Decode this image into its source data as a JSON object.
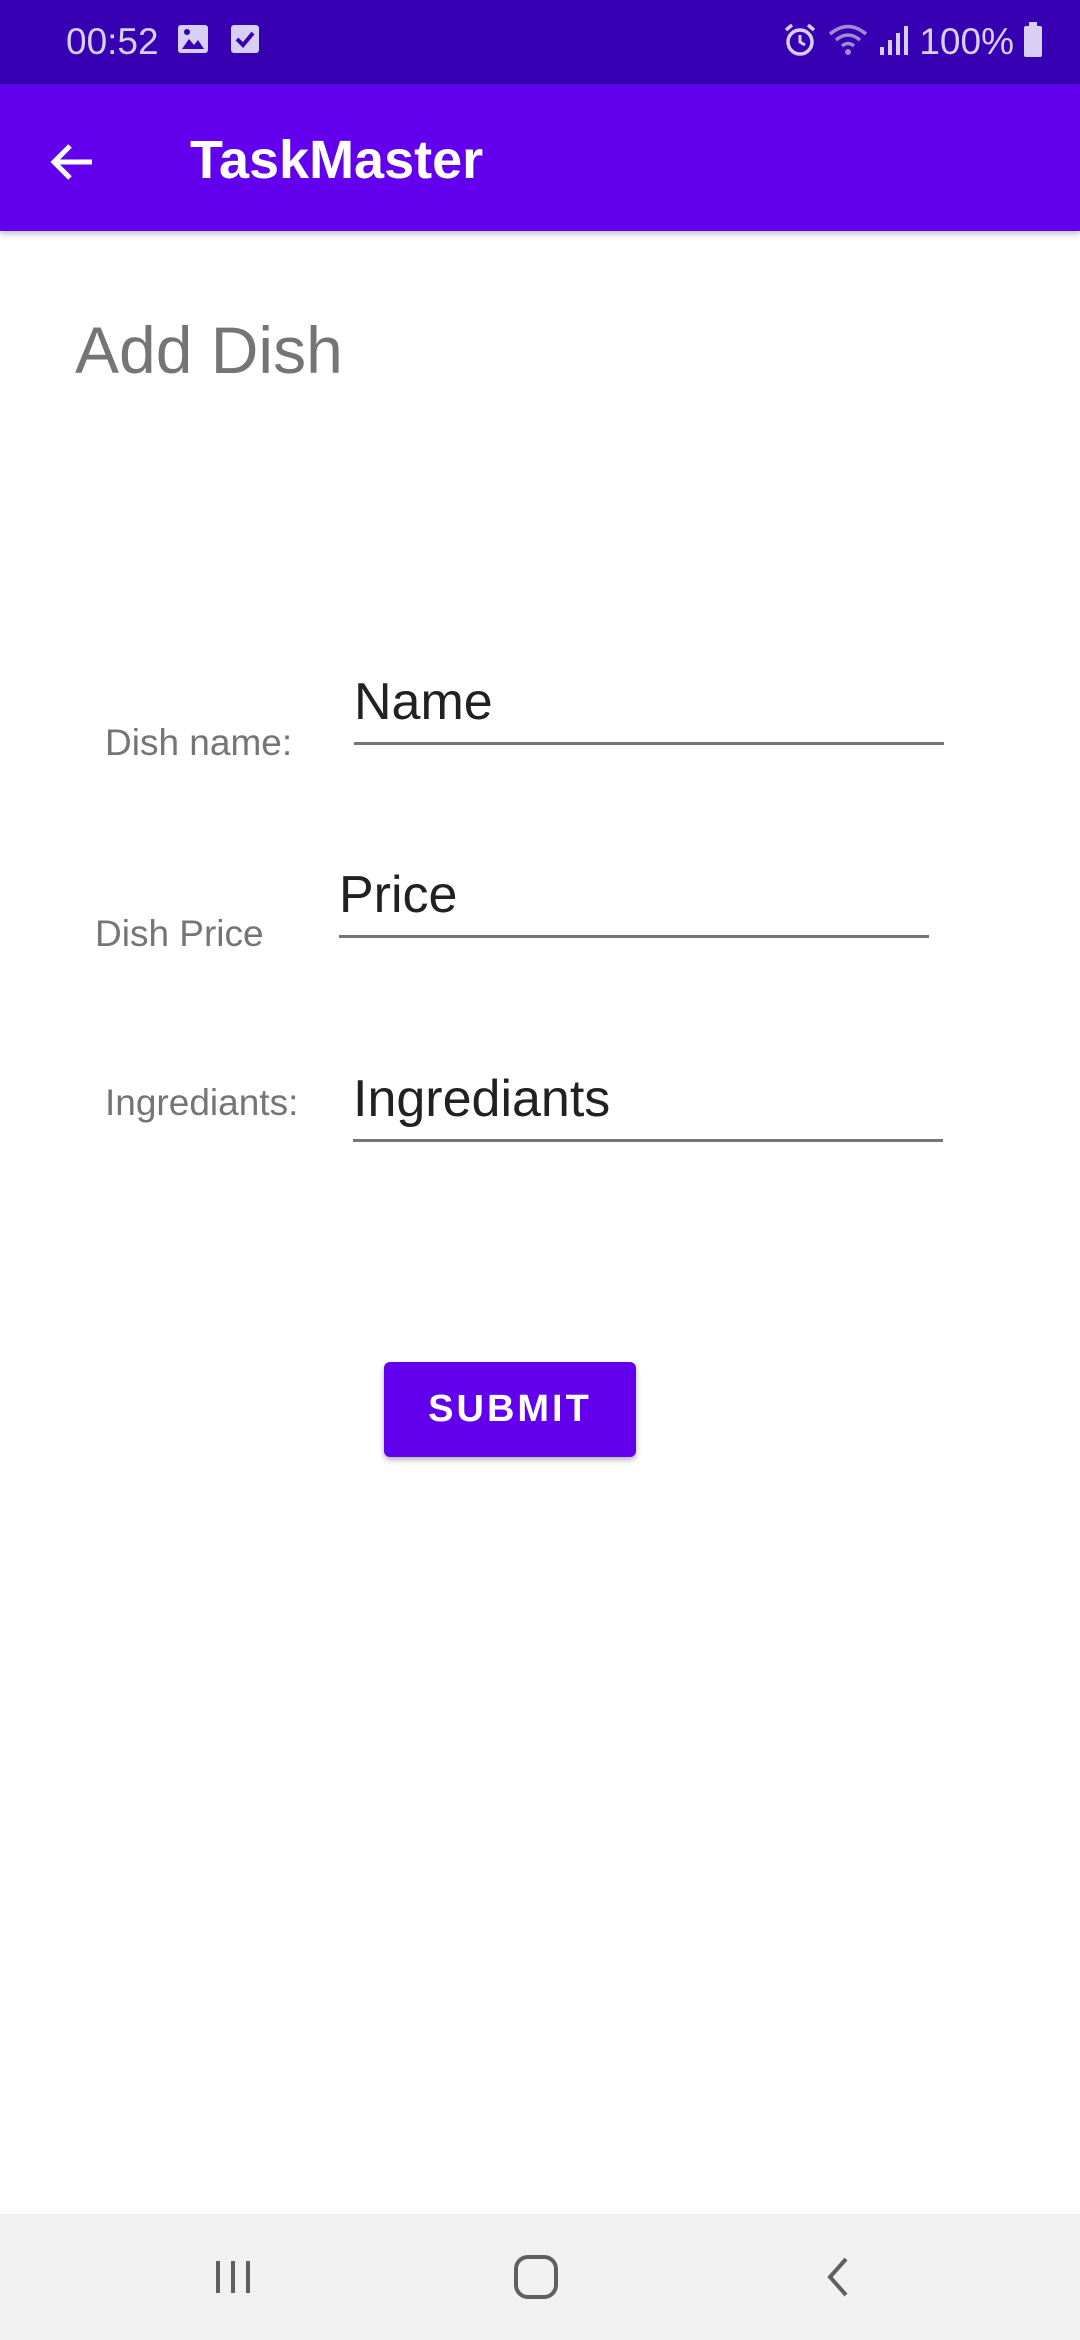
{
  "status_bar": {
    "time": "00:52",
    "battery_text": "100%",
    "left_icons": [
      "gallery-icon",
      "checkbox-icon"
    ],
    "right_icons": [
      "alarm-icon",
      "wifi-icon",
      "signal-icon",
      "battery-icon"
    ]
  },
  "app_bar": {
    "title": "TaskMaster",
    "back_icon": "back-arrow-icon"
  },
  "page": {
    "heading": "Add Dish"
  },
  "form": {
    "name_label": "Dish name:",
    "name_placeholder": "Name",
    "price_label": "Dish Price",
    "price_placeholder": "Price",
    "ingredients_label": "Ingrediants:",
    "ingredients_placeholder": "Ingrediants",
    "submit_label": "SUBMIT"
  },
  "nav_bar": {
    "items": [
      "recents-icon",
      "home-icon",
      "back-icon"
    ]
  },
  "colors": {
    "status_bar": "#3700b3",
    "primary": "#6200ee",
    "label_gray": "#757575"
  }
}
